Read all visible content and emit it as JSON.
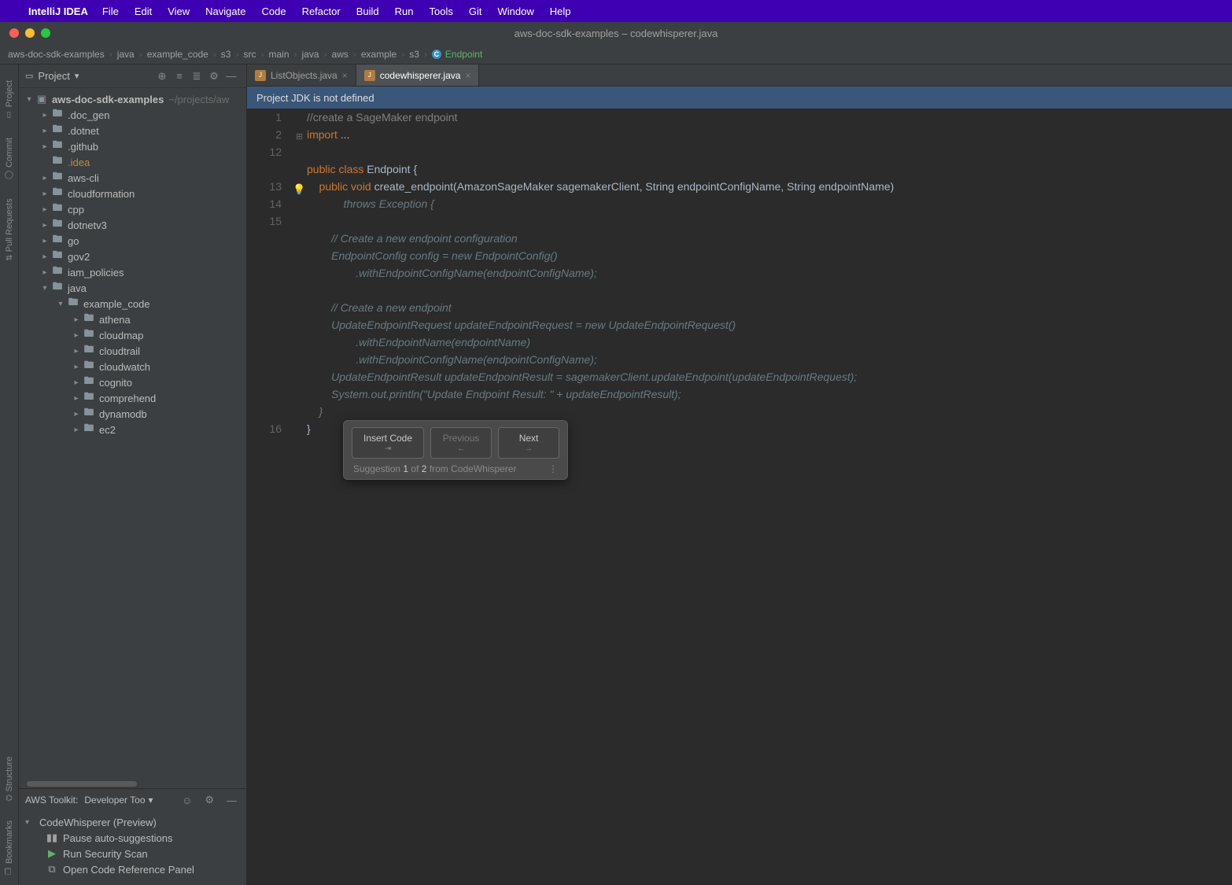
{
  "menubar": {
    "app": "IntelliJ IDEA",
    "items": [
      "File",
      "Edit",
      "View",
      "Navigate",
      "Code",
      "Refactor",
      "Build",
      "Run",
      "Tools",
      "Git",
      "Window",
      "Help"
    ]
  },
  "titlebar": {
    "title": "aws-doc-sdk-examples – codewhisperer.java"
  },
  "breadcrumbs": [
    "aws-doc-sdk-examples",
    "java",
    "example_code",
    "s3",
    "src",
    "main",
    "java",
    "aws",
    "example",
    "s3"
  ],
  "breadcrumb_last": "Endpoint",
  "sidebar": {
    "header": {
      "label": "Project"
    },
    "root": {
      "name": "aws-doc-sdk-examples",
      "path": "~/projects/aw"
    },
    "items": [
      {
        "depth": 1,
        "arrow": ">",
        "name": ".doc_gen",
        "type": "folder"
      },
      {
        "depth": 1,
        "arrow": ">",
        "name": ".dotnet",
        "type": "folder"
      },
      {
        "depth": 1,
        "arrow": ">",
        "name": ".github",
        "type": "folder"
      },
      {
        "depth": 1,
        "arrow": "",
        "name": ".idea",
        "type": "folder",
        "style": "idea"
      },
      {
        "depth": 1,
        "arrow": ">",
        "name": "aws-cli",
        "type": "folder"
      },
      {
        "depth": 1,
        "arrow": ">",
        "name": "cloudformation",
        "type": "folder"
      },
      {
        "depth": 1,
        "arrow": ">",
        "name": "cpp",
        "type": "folder"
      },
      {
        "depth": 1,
        "arrow": ">",
        "name": "dotnetv3",
        "type": "folder"
      },
      {
        "depth": 1,
        "arrow": ">",
        "name": "go",
        "type": "folder"
      },
      {
        "depth": 1,
        "arrow": ">",
        "name": "gov2",
        "type": "folder"
      },
      {
        "depth": 1,
        "arrow": ">",
        "name": "iam_policies",
        "type": "folder"
      },
      {
        "depth": 1,
        "arrow": "v",
        "name": "java",
        "type": "folder"
      },
      {
        "depth": 2,
        "arrow": "v",
        "name": "example_code",
        "type": "folder"
      },
      {
        "depth": 3,
        "arrow": ">",
        "name": "athena",
        "type": "folder"
      },
      {
        "depth": 3,
        "arrow": ">",
        "name": "cloudmap",
        "type": "folder"
      },
      {
        "depth": 3,
        "arrow": ">",
        "name": "cloudtrail",
        "type": "folder"
      },
      {
        "depth": 3,
        "arrow": ">",
        "name": "cloudwatch",
        "type": "folder"
      },
      {
        "depth": 3,
        "arrow": ">",
        "name": "cognito",
        "type": "folder"
      },
      {
        "depth": 3,
        "arrow": ">",
        "name": "comprehend",
        "type": "folder"
      },
      {
        "depth": 3,
        "arrow": ">",
        "name": "dynamodb",
        "type": "folder"
      },
      {
        "depth": 3,
        "arrow": ">",
        "name": "ec2",
        "type": "folder"
      }
    ]
  },
  "gutter_labels": [
    "Project",
    "Commit",
    "Pull Requests",
    "Structure",
    "Bookmarks"
  ],
  "aws": {
    "title": "AWS Toolkit:",
    "dropdown": "Developer Too",
    "section": "CodeWhisperer (Preview)",
    "actions": {
      "pause": "Pause auto-suggestions",
      "scan": "Run Security Scan",
      "ref": "Open Code Reference Panel"
    }
  },
  "tabs": [
    {
      "name": "ListObjects.java",
      "active": false
    },
    {
      "name": "codewhisperer.java",
      "active": true
    }
  ],
  "banner": "Project JDK is not defined",
  "code": {
    "line_numbers": [
      "1",
      "2",
      "12",
      "",
      "13",
      "14",
      "15",
      "",
      "",
      "",
      "",
      "",
      "",
      "",
      "",
      "",
      "",
      "",
      "16"
    ],
    "lines": [
      [
        {
          "t": "//create a SageMaker endpoint",
          "cls": "c-cmt"
        }
      ],
      [
        {
          "t": "import ",
          "cls": "c-kw"
        },
        {
          "t": "...",
          "cls": "c-dots"
        }
      ],
      [
        {
          "t": "",
          "cls": ""
        }
      ],
      [
        {
          "t": "public ",
          "cls": "c-kw"
        },
        {
          "t": "class ",
          "cls": "c-kw"
        },
        {
          "t": "Endpoint ",
          "cls": "c-type"
        },
        {
          "t": "{",
          "cls": "c-id"
        }
      ],
      [
        {
          "t": "    public ",
          "cls": "c-kw"
        },
        {
          "t": "void ",
          "cls": "c-kw"
        },
        {
          "t": "create_endpoint",
          "cls": "c-id"
        },
        {
          "t": "(AmazonSageMaker sagemakerClient, String endpointConfigName, String endpointName)",
          "cls": "c-id"
        }
      ],
      [
        {
          "t": "            throws Exception {",
          "cls": "c-sugg"
        }
      ],
      [
        {
          "t": "",
          "cls": ""
        }
      ],
      [
        {
          "t": "        // Create a new endpoint configuration",
          "cls": "c-sugg"
        }
      ],
      [
        {
          "t": "        EndpointConfig config = new EndpointConfig()",
          "cls": "c-sugg"
        }
      ],
      [
        {
          "t": "                .withEndpointConfigName(endpointConfigName);",
          "cls": "c-sugg"
        }
      ],
      [
        {
          "t": "",
          "cls": ""
        }
      ],
      [
        {
          "t": "        // Create a new endpoint",
          "cls": "c-sugg"
        }
      ],
      [
        {
          "t": "        UpdateEndpointRequest updateEndpointRequest = new UpdateEndpointRequest()",
          "cls": "c-sugg"
        }
      ],
      [
        {
          "t": "                .withEndpointName(endpointName)",
          "cls": "c-sugg"
        }
      ],
      [
        {
          "t": "                .withEndpointConfigName(endpointConfigName);",
          "cls": "c-sugg"
        }
      ],
      [
        {
          "t": "        UpdateEndpointResult updateEndpointResult = sagemakerClient.updateEndpoint(updateEndpointRequest);",
          "cls": "c-sugg"
        }
      ],
      [
        {
          "t": "        System.out.println(\"Update Endpoint Result: \" + updateEndpointResult);",
          "cls": "c-sugg"
        }
      ],
      [
        {
          "t": "    }",
          "cls": "c-sugg"
        }
      ],
      [
        {
          "t": "}",
          "cls": "c-id"
        }
      ]
    ]
  },
  "suggestion": {
    "insert": "Insert Code",
    "insert_key": "⇥",
    "prev": "Previous",
    "prev_key": "←",
    "next": "Next",
    "next_key": "→",
    "label_a": "Suggestion ",
    "current": "1",
    "label_b": " of ",
    "total": "2",
    "label_c": " from CodeWhisperer"
  }
}
